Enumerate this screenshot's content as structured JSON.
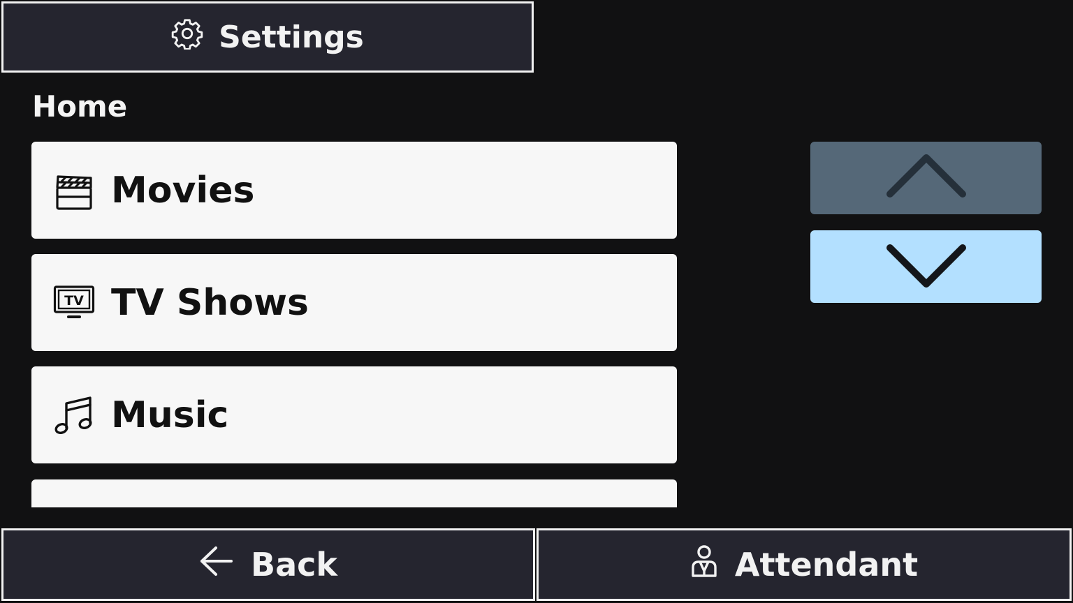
{
  "header": {
    "settings_label": "Settings",
    "settings_icon": "gear-icon"
  },
  "section": {
    "title": "Home"
  },
  "menu": {
    "items": [
      {
        "label": "Movies",
        "icon": "clapperboard-icon"
      },
      {
        "label": "TV Shows",
        "icon": "tv-icon",
        "icon_text": "TV"
      },
      {
        "label": "Music",
        "icon": "music-note-icon"
      },
      {
        "label": "",
        "icon": ""
      }
    ]
  },
  "scroll": {
    "up_icon": "chevron-up-icon",
    "down_icon": "chevron-down-icon"
  },
  "footer": {
    "back_label": "Back",
    "back_icon": "arrow-left-icon",
    "attendant_label": "Attendant",
    "attendant_icon": "attendant-icon"
  },
  "colors": {
    "background": "#111112",
    "button_dark": "#25252f",
    "list_item": "#f7f7f7",
    "scroll_up": "#556878",
    "scroll_down": "#b3e0ff",
    "text_light": "#f2f2f2"
  }
}
